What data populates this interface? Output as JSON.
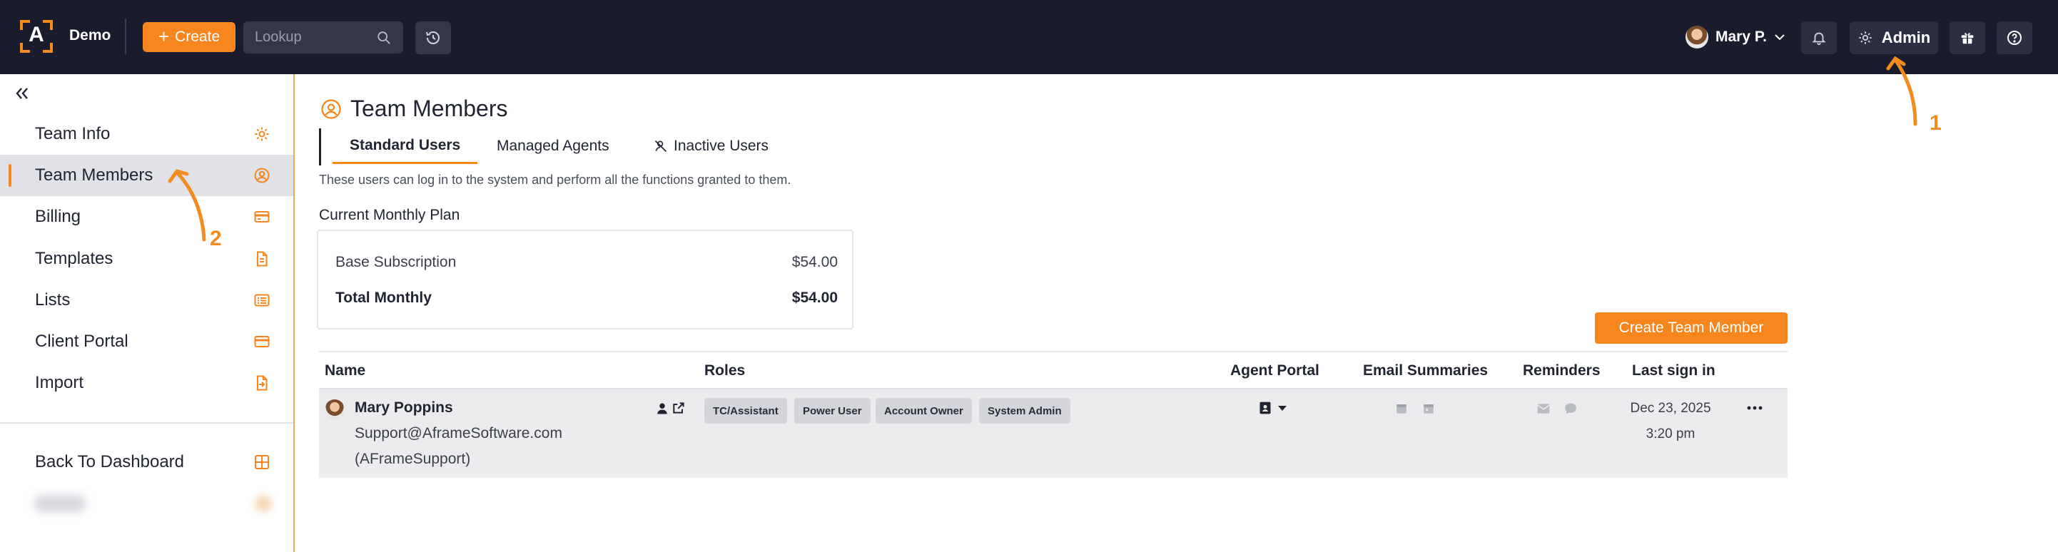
{
  "topbar": {
    "logo_letter": "A",
    "org_name": "Demo",
    "create_label": "Create",
    "lookup_placeholder": "Lookup",
    "user_name": "Mary P.",
    "admin_label": "Admin"
  },
  "sidebar": {
    "items": [
      {
        "label": "Team Info",
        "icon": "gear-icon"
      },
      {
        "label": "Team Members",
        "icon": "user-circle-icon"
      },
      {
        "label": "Billing",
        "icon": "credit-card-icon"
      },
      {
        "label": "Templates",
        "icon": "document-icon"
      },
      {
        "label": "Lists",
        "icon": "list-icon"
      },
      {
        "label": "Client Portal",
        "icon": "portal-card-icon"
      },
      {
        "label": "Import",
        "icon": "file-import-icon"
      }
    ],
    "back_label": "Back To Dashboard",
    "back_icon": "grid-icon"
  },
  "annotations": {
    "one": "1",
    "two": "2"
  },
  "page": {
    "title": "Team Members",
    "tabs": [
      "Standard Users",
      "Managed Agents",
      "Inactive Users"
    ],
    "active_tab": "Standard Users",
    "description": "These users can log in to the system and perform all the functions granted to them.",
    "plan_title": "Current Monthly Plan",
    "plan": {
      "base_label": "Base Subscription",
      "base_value": "$54.00",
      "total_label": "Total Monthly",
      "total_value": "$54.00"
    },
    "create_member_label": "Create Team Member"
  },
  "table": {
    "columns": [
      "Name",
      "Roles",
      "Agent Portal",
      "Email Summaries",
      "Reminders",
      "Last sign in"
    ],
    "rows": [
      {
        "name": "Mary Poppins",
        "email": "Support@AframeSoftware.com",
        "handle": "(AFrameSupport)",
        "roles": [
          "TC/Assistant",
          "Power User",
          "Account Owner",
          "System Admin"
        ],
        "last_sign_in_date": "Dec 23, 2025",
        "last_sign_in_time": "3:20 pm"
      }
    ]
  },
  "colors": {
    "accent": "#f7861e",
    "topbar": "#1a1c2e",
    "row_bg": "#ececef"
  }
}
